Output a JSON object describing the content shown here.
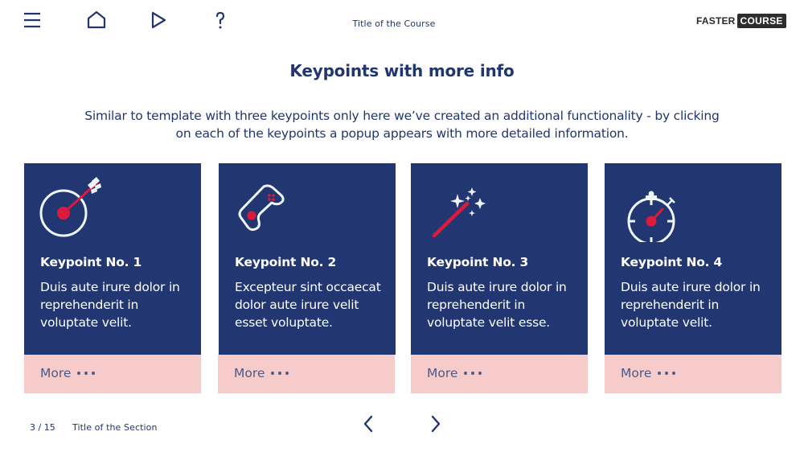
{
  "header": {
    "course_title": "Title of the Course",
    "logo": {
      "part1": "FASTER",
      "part2": "COURSE"
    },
    "nav_icons": [
      "menu-icon",
      "home-icon",
      "play-icon",
      "help-icon"
    ]
  },
  "main": {
    "title": "Keypoints with more info",
    "intro": "Similar to template with three keypoints only here we’ve created an additional functionality - by clicking on each of the keypoints a popup appears with more detailed information.",
    "cards": [
      {
        "icon": "target-arrow-icon",
        "title": "Keypoint No. 1",
        "text": "Duis aute irure dolor in reprehenderit in voluptate velit.",
        "more_label": "More"
      },
      {
        "icon": "gamepad-icon",
        "title": "Keypoint No. 2",
        "text": "Excepteur sint occaecat dolor aute irure velit esset voluptate.",
        "more_label": "More"
      },
      {
        "icon": "magic-wand-icon",
        "title": "Keypoint No. 3",
        "text": "Duis aute irure dolor in reprehenderit in voluptate velit esse.",
        "more_label": "More"
      },
      {
        "icon": "stopwatch-icon",
        "title": "Keypoint No. 4",
        "text": "Duis aute irure dolor in reprehenderit in voluptate velit.",
        "more_label": "More"
      }
    ]
  },
  "footer": {
    "page_indicator": "3 / 15",
    "section_title": "Title of the Section"
  },
  "colors": {
    "primary": "#223671",
    "accent": "#dc1a3c",
    "more_bg": "#f8cbcb",
    "icon_light": "#eef6fb"
  }
}
